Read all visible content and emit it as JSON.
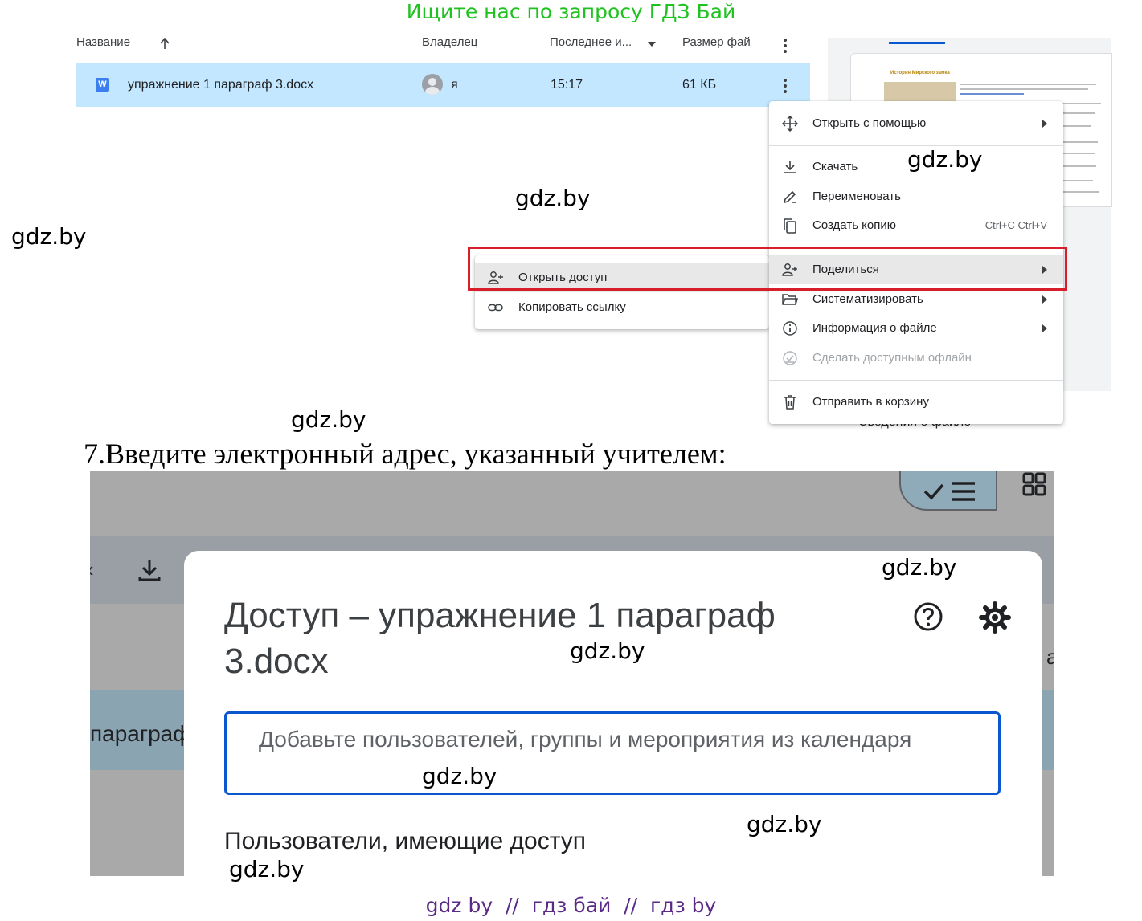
{
  "promo": "Ищите нас по запросу ГДЗ Бай",
  "list": {
    "columns": {
      "name": "Название",
      "owner": "Владелец",
      "modified": "Последнее и...",
      "size": "Размер фай"
    },
    "file": {
      "type_letter": "W",
      "name": "упражнение 1 параграф 3.docx",
      "owner": "я",
      "modified": "15:17",
      "size": "61 КБ"
    }
  },
  "preview": {
    "doc_title": "История Мирского замка",
    "bottom_label": "Сведения о файле"
  },
  "context_menu": {
    "items": [
      {
        "label": "Открыть с помощью",
        "shortcut": "",
        "submenu": true
      },
      {
        "label": "Скачать",
        "shortcut": "",
        "submenu": false
      },
      {
        "label": "Переименовать",
        "shortcut": "",
        "submenu": false
      },
      {
        "label": "Создать копию",
        "shortcut": "Ctrl+C Ctrl+V",
        "submenu": false
      },
      {
        "label": "Поделиться",
        "shortcut": "",
        "submenu": true
      },
      {
        "label": "Систематизировать",
        "shortcut": "",
        "submenu": true
      },
      {
        "label": "Информация о файле",
        "shortcut": "",
        "submenu": true
      },
      {
        "label": "Сделать доступным офлайн",
        "shortcut": "",
        "submenu": false,
        "disabled": true
      },
      {
        "label": "Отправить в корзину",
        "shortcut": "",
        "submenu": false
      }
    ]
  },
  "share_submenu": {
    "items": [
      {
        "label": "Открыть доступ"
      },
      {
        "label": "Копировать ссылку"
      }
    ]
  },
  "step_text": "7.Введите электронный адрес, указанный учителем:",
  "share_dialog": {
    "title": "Доступ – упражнение 1 параграф 3.docx",
    "add_placeholder": "Добавьте пользователей, группы и мероприятия из календаря",
    "people_with_access": "Пользователи, имеющие доступ",
    "bg_text": "параграф",
    "bg_right_char": "а",
    "bg_left_char": "‹"
  },
  "watermarks": [
    "gdz.by",
    "gdz.by",
    "gdz.by",
    "gdz.by",
    "gdz.by",
    "gdz.by",
    "gdz.by",
    "gdz.by",
    "gdz.by"
  ],
  "footer": "gdz by  //  гдз бай  //  гдз by",
  "colors": {
    "promo": "#1fc21f",
    "row_selected": "#c2e7ff",
    "highlight_box": "#d81e2a",
    "input_border": "#0b57d0",
    "footer": "#5b2a86"
  }
}
